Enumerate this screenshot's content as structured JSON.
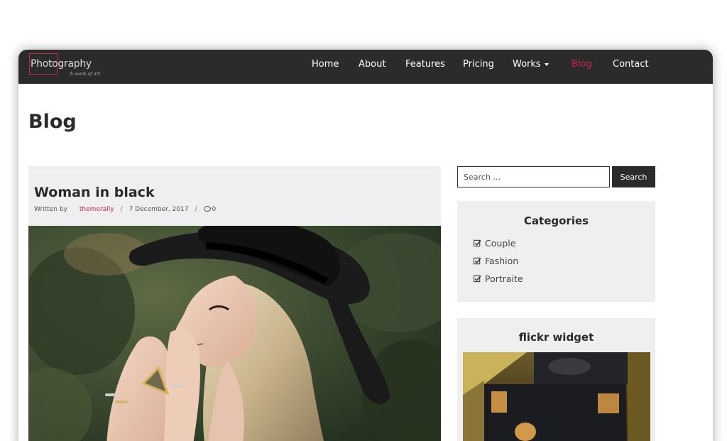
{
  "logo": {
    "text": "Photography",
    "tagline": "A work of art"
  },
  "nav": {
    "items": [
      {
        "label": "Home"
      },
      {
        "label": "About"
      },
      {
        "label": "Features"
      },
      {
        "label": "Pricing"
      },
      {
        "label": "Works"
      },
      {
        "label": "Blog"
      },
      {
        "label": "Contact"
      }
    ],
    "active": "Blog"
  },
  "page": {
    "title": "Blog"
  },
  "post": {
    "title": "Woman in black",
    "written_by": "Written by",
    "author": "themerally",
    "separator": "/",
    "date": "7 December, 2017",
    "comments": "0"
  },
  "sidebar": {
    "search": {
      "placeholder": "Search …",
      "button": "Search"
    },
    "categories": {
      "title": "Categories",
      "items": [
        "Couple",
        "Fashion",
        "Portraite"
      ]
    },
    "flickr": {
      "title": "flickr widget"
    }
  },
  "colors": {
    "accent": "#c8284d",
    "navbar": "#2b2b2b",
    "panel": "#efefef"
  }
}
